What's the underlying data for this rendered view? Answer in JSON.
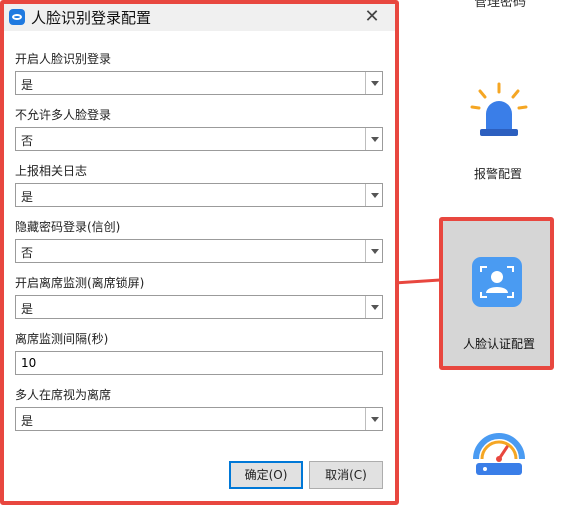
{
  "dialog": {
    "title": "人脸识别登录配置",
    "close_glyph": "✕",
    "fields": [
      {
        "label": "开启人脸识别登录",
        "value": "是"
      },
      {
        "label": "不允许多人脸登录",
        "value": "否"
      },
      {
        "label": "上报相关日志",
        "value": "是"
      },
      {
        "label": "隐藏密码登录(信创)",
        "value": "否"
      },
      {
        "label": "开启离席监测(离席锁屏)",
        "value": "是"
      },
      {
        "label": "离席监测间隔(秒)",
        "value": "10"
      },
      {
        "label": "多人在席视为离席",
        "value": "是"
      }
    ],
    "ok_label": "确定(O)",
    "cancel_label": "取消(C)"
  },
  "background": {
    "clipped_text": "管理密码",
    "alarm_label": "报警配置",
    "face_label": "人脸认证配置"
  },
  "colors": {
    "highlight": "#e8473f",
    "accent": "#4a9bf2",
    "tile_bg": "#d6d6d6"
  }
}
